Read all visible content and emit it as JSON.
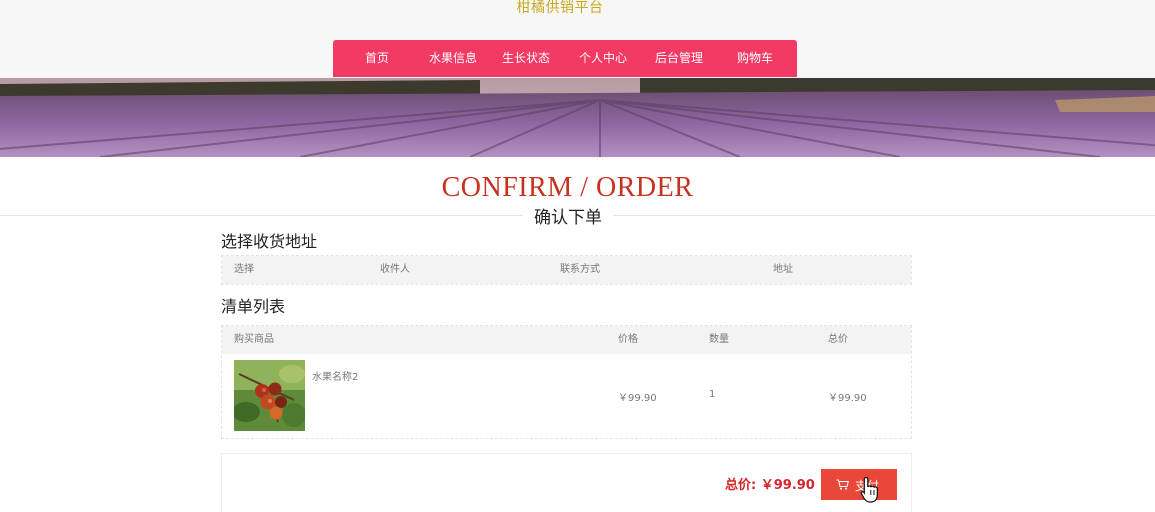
{
  "site": {
    "title": "柑橘供销平台"
  },
  "nav": {
    "items": [
      "首页",
      "水果信息",
      "生长状态",
      "个人中心",
      "后台管理",
      "购物车"
    ]
  },
  "heading": {
    "en": "CONFIRM / ORDER",
    "cn": "确认下单"
  },
  "address": {
    "title": "选择收货地址",
    "columns": [
      "选择",
      "收件人",
      "联系方式",
      "地址"
    ]
  },
  "order": {
    "title": "清单列表",
    "columns": [
      "购买商品",
      "价格",
      "数量",
      "总价"
    ],
    "rows": [
      {
        "name": "水果名称2",
        "price": "￥99.90",
        "qty": "1",
        "total": "￥99.90"
      }
    ]
  },
  "summary": {
    "total_label": "总价: ￥99.90",
    "pay_label": "支付"
  },
  "colors": {
    "nav": "#f33a65",
    "title": "#c8a91c",
    "accent": "#c8311f",
    "pay": "#e9473a"
  }
}
